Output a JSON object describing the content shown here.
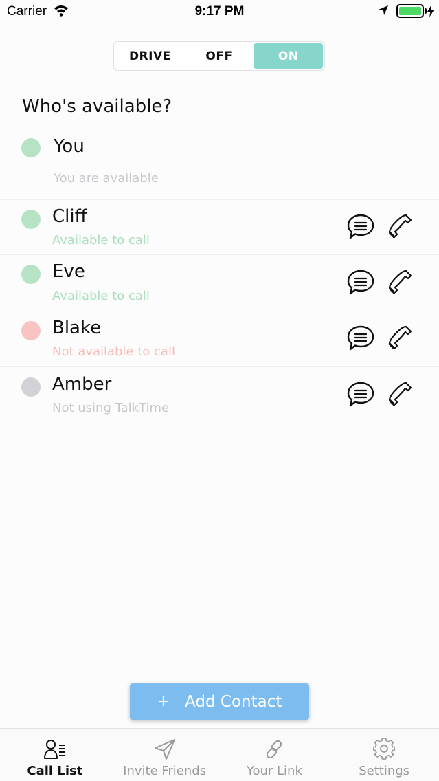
{
  "status_bar": {
    "carrier": "Carrier",
    "time": "9:17 PM"
  },
  "mode": {
    "options": [
      "DRIVE",
      "OFF",
      "ON"
    ],
    "selected": "ON"
  },
  "heading": "Who's available?",
  "contacts": [
    {
      "name": "You",
      "status": "You are available",
      "dot_color": "#b5e3c3",
      "status_color": "#c8c8cc",
      "actions": false
    },
    {
      "name": "Cliff",
      "status": "Available to call",
      "dot_color": "#b5e3c3",
      "status_color": "#a9dfbb",
      "actions": true
    },
    {
      "name": "Eve",
      "status": "Available to call",
      "dot_color": "#b5e3c3",
      "status_color": "#a9dfbb",
      "actions": true
    },
    {
      "name": "Blake",
      "status": "Not available to call",
      "dot_color": "#f8c3c0",
      "status_color": "#f6bcb6",
      "actions": true
    },
    {
      "name": "Amber",
      "status": "Not using TalkTime",
      "dot_color": "#d1d1d6",
      "status_color": "#c8c8cc",
      "actions": true
    }
  ],
  "add_contact": {
    "icon": "+",
    "label": "Add Contact"
  },
  "tabs": [
    {
      "label": "Call List",
      "icon": "call-list-icon",
      "active": true
    },
    {
      "label": "Invite Friends",
      "icon": "paper-plane-icon",
      "active": false
    },
    {
      "label": "Your Link",
      "icon": "link-icon",
      "active": false
    },
    {
      "label": "Settings",
      "icon": "gear-icon",
      "active": false
    }
  ],
  "colors": {
    "accent": "#86d6cc",
    "button": "#7dbcee"
  }
}
